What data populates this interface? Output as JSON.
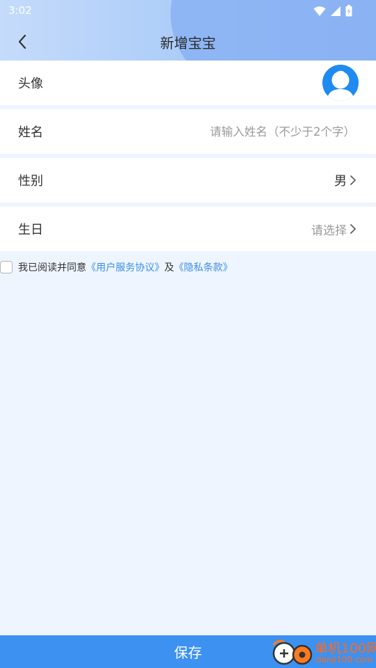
{
  "status_bar": {
    "time": "3:02",
    "icons": [
      "wifi-icon",
      "signal-icon",
      "battery-icon"
    ]
  },
  "header": {
    "title": "新增宝宝",
    "back_icon": "chevron-left-icon"
  },
  "form": {
    "avatar": {
      "label": "头像"
    },
    "name": {
      "label": "姓名",
      "placeholder": "请输入姓名（不少于2个字）",
      "value": ""
    },
    "gender": {
      "label": "性别",
      "value": "男"
    },
    "birthday": {
      "label": "生日",
      "placeholder": "请选择"
    }
  },
  "agreement": {
    "prefix": "我已阅读并同意",
    "link1": "《用户服务协议》",
    "middle": "及",
    "link2": "《隐私条款》",
    "checked": false
  },
  "footer": {
    "save_label": "保存"
  },
  "watermark": {
    "line1": "单机100网",
    "line2": "danji100.com"
  },
  "colors": {
    "primary": "#3d91f1",
    "link": "#3b8ee8",
    "avatar_bg": "#1f8bf0",
    "background": "#eef5fe"
  }
}
